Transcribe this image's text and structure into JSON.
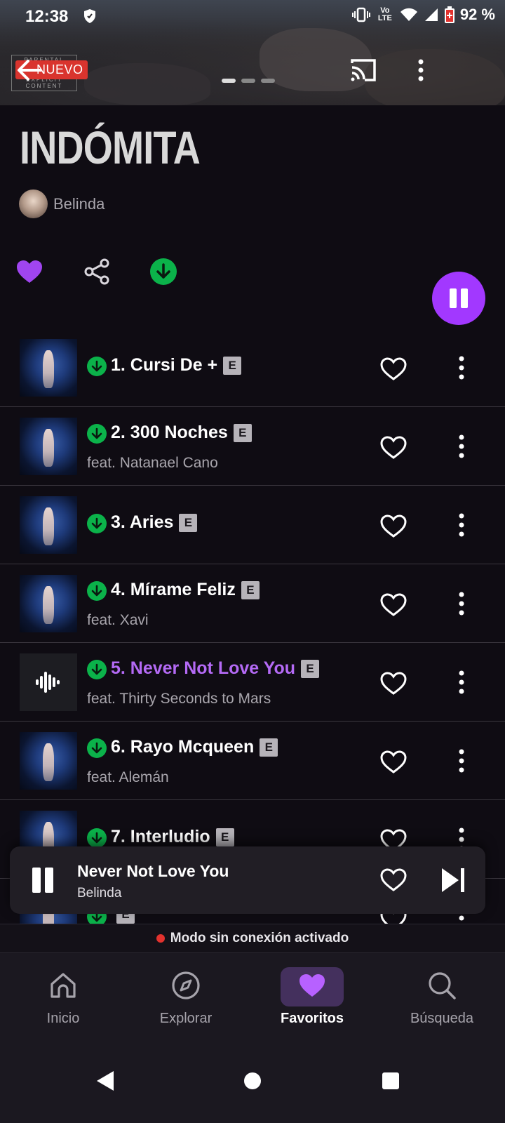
{
  "status_bar": {
    "time": "12:38",
    "network": "Vo LTE",
    "battery": "92 %"
  },
  "header": {
    "badge_new": "NUEVO",
    "parental_line1": "PARENTAL",
    "parental_line2": "EXPLICIT CONTENT",
    "page_indicator": {
      "count": 3,
      "active": 0
    }
  },
  "album": {
    "title": "INDÓMITA",
    "artist": "Belinda"
  },
  "colors": {
    "accent": "#a238ff",
    "playing_text": "#b46af5",
    "download_green": "#0bb24a",
    "offline_dot": "#e3322e"
  },
  "tracks": [
    {
      "title": "1. Cursi De +",
      "explicit": "E",
      "feat": "",
      "playing": false
    },
    {
      "title": "2. 300 Noches",
      "explicit": "E",
      "feat": "feat. Natanael Cano",
      "playing": false
    },
    {
      "title": "3. Aries",
      "explicit": "E",
      "feat": "",
      "playing": false
    },
    {
      "title": "4. Mírame Feliz",
      "explicit": "E",
      "feat": "feat. Xavi",
      "playing": false
    },
    {
      "title": "5. Never Not Love You",
      "explicit": "E",
      "feat": "feat. Thirty Seconds to Mars",
      "playing": true
    },
    {
      "title": "6. Rayo Mcqueen",
      "explicit": "E",
      "feat": "feat. Alemán",
      "playing": false
    },
    {
      "title": "7. Interludio",
      "explicit": "E",
      "feat": "",
      "playing": false
    },
    {
      "title": "",
      "explicit": "E",
      "feat": "",
      "playing": false
    }
  ],
  "mini_player": {
    "title": "Never Not Love You",
    "artist": "Belinda"
  },
  "offline_banner": "Modo sin conexión activado",
  "bottom_nav": [
    {
      "label": "Inicio",
      "icon": "home-icon",
      "active": false
    },
    {
      "label": "Explorar",
      "icon": "compass-icon",
      "active": false
    },
    {
      "label": "Favoritos",
      "icon": "heart-icon",
      "active": true
    },
    {
      "label": "Búsqueda",
      "icon": "search-icon",
      "active": false
    }
  ]
}
